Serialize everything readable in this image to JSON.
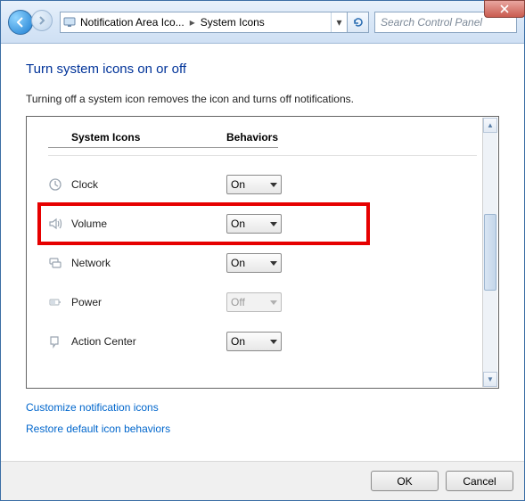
{
  "titlebar": {
    "breadcrumb1": "Notification Area Ico...",
    "breadcrumb2": "System Icons",
    "search_placeholder": "Search Control Panel"
  },
  "page": {
    "title": "Turn system icons on or off",
    "description": "Turning off a system icon removes the icon and turns off notifications."
  },
  "headers": {
    "col1": "System Icons",
    "col2": "Behaviors"
  },
  "rows": [
    {
      "label": "Clock",
      "value": "On",
      "disabled": false,
      "icon": "clock-icon",
      "highlight": false
    },
    {
      "label": "Volume",
      "value": "On",
      "disabled": false,
      "icon": "volume-icon",
      "highlight": true
    },
    {
      "label": "Network",
      "value": "On",
      "disabled": false,
      "icon": "network-icon",
      "highlight": false
    },
    {
      "label": "Power",
      "value": "Off",
      "disabled": true,
      "icon": "power-icon",
      "highlight": false
    },
    {
      "label": "Action Center",
      "value": "On",
      "disabled": false,
      "icon": "action-center-icon",
      "highlight": false
    }
  ],
  "links": {
    "customize": "Customize notification icons",
    "restore": "Restore default icon behaviors"
  },
  "footer": {
    "ok": "OK",
    "cancel": "Cancel"
  }
}
